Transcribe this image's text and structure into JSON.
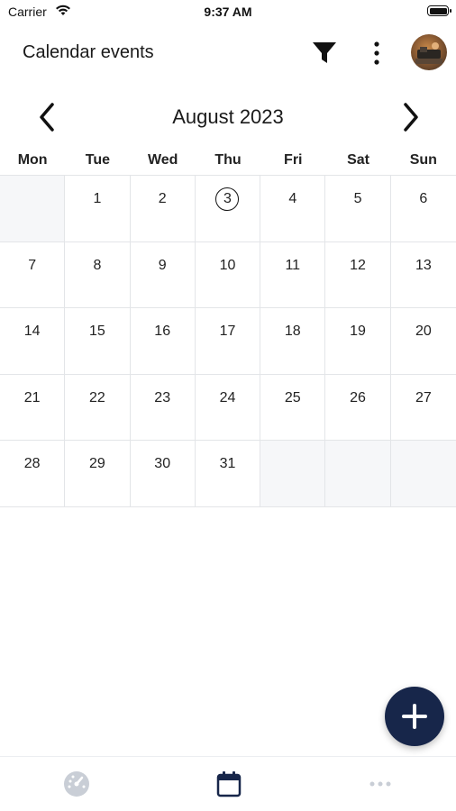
{
  "status_bar": {
    "carrier": "Carrier",
    "time": "9:37 AM",
    "wifi_icon": "wifi-icon",
    "battery_icon": "battery-icon"
  },
  "app_bar": {
    "title": "Calendar events",
    "filter_icon": "filter-icon",
    "more_icon": "more-vertical-icon",
    "avatar": "user-avatar"
  },
  "calendar": {
    "month_label": "August 2023",
    "prev_icon": "chevron-left-icon",
    "next_icon": "chevron-right-icon",
    "weekdays": [
      "Mon",
      "Tue",
      "Wed",
      "Thu",
      "Fri",
      "Sat",
      "Sun"
    ],
    "weeks": [
      [
        "",
        "1",
        "2",
        "3",
        "4",
        "5",
        "6"
      ],
      [
        "7",
        "8",
        "9",
        "10",
        "11",
        "12",
        "13"
      ],
      [
        "14",
        "15",
        "16",
        "17",
        "18",
        "19",
        "20"
      ],
      [
        "21",
        "22",
        "23",
        "24",
        "25",
        "26",
        "27"
      ],
      [
        "28",
        "29",
        "30",
        "31",
        "",
        "",
        ""
      ]
    ],
    "today": "3"
  },
  "fab": {
    "icon": "plus-icon"
  },
  "bottom_nav": {
    "items": [
      {
        "icon": "dashboard-icon",
        "active": false
      },
      {
        "icon": "calendar-icon",
        "active": true
      },
      {
        "icon": "more-horizontal-icon",
        "active": false
      }
    ]
  },
  "colors": {
    "accent": "#17264a",
    "grid_line": "#e3e5e8",
    "empty_cell": "#f6f7f9",
    "inactive_icon": "#c9ced6"
  }
}
